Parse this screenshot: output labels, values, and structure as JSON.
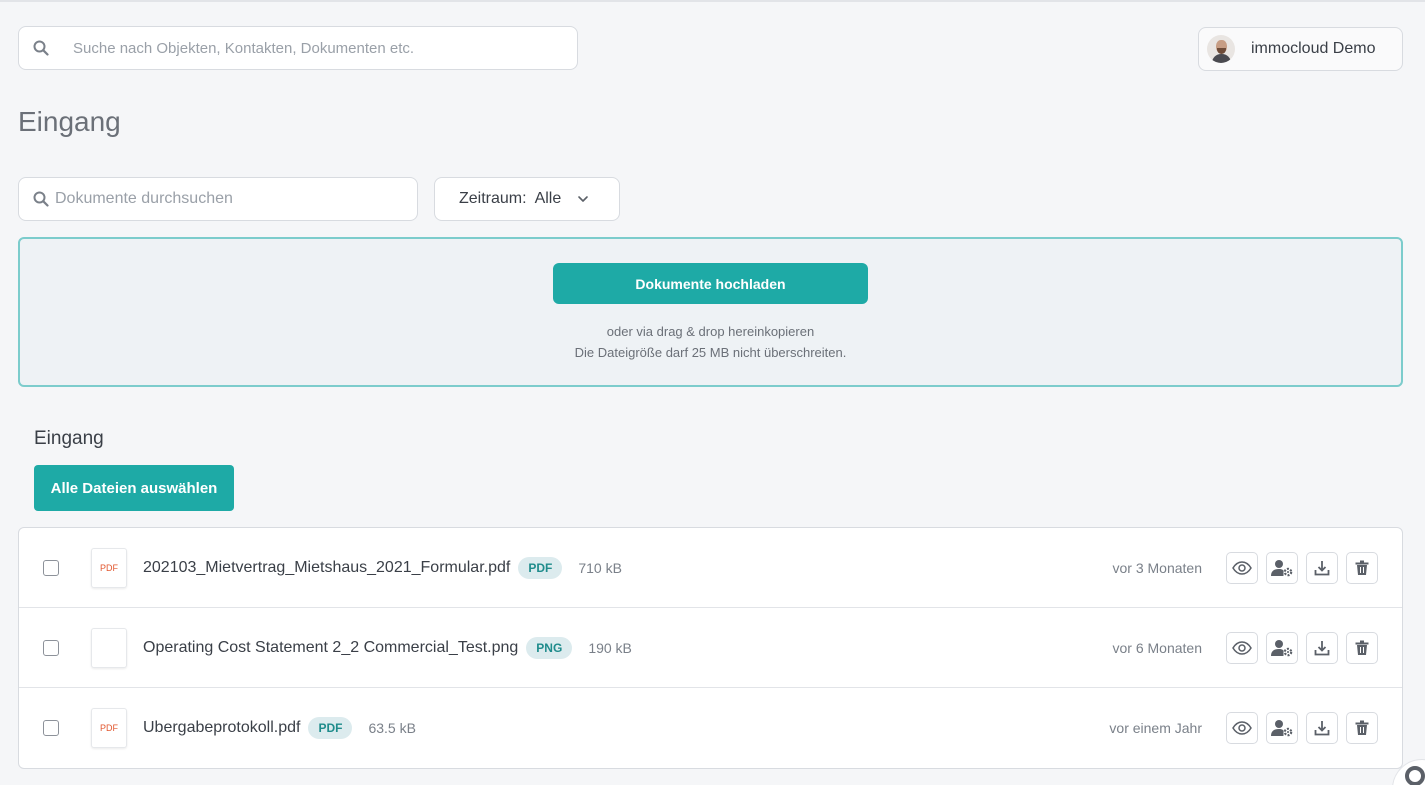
{
  "header": {
    "search_placeholder": "Suche nach Objekten, Kontakten, Dokumenten etc.",
    "user_name": "immocloud Demo"
  },
  "page": {
    "title": "Eingang"
  },
  "filters": {
    "doc_search_placeholder": "Dokumente durchsuchen",
    "period_label": "Zeitraum:",
    "period_value": "Alle"
  },
  "upload": {
    "button_label": "Dokumente hochladen",
    "hint_line1": "oder via drag & drop hereinkopieren",
    "hint_line2": "Die Dateigröße darf 25 MB nicht überschreiten."
  },
  "list": {
    "section_title": "Eingang",
    "select_all_label": "Alle Dateien auswählen",
    "files": [
      {
        "name": "202103_Mietvertrag_Mietshaus_2021_Formular.pdf",
        "type": "PDF",
        "size": "710 kB",
        "date": "vor 3 Monaten",
        "thumb": "PDF"
      },
      {
        "name": "Operating Cost Statement 2_2 Commercial_Test.png",
        "type": "PNG",
        "size": "190 kB",
        "date": "vor 6 Monaten",
        "thumb": ""
      },
      {
        "name": "Ubergabeprotokoll.pdf",
        "type": "PDF",
        "size": "63.5 kB",
        "date": "vor einem Jahr",
        "thumb": "PDF"
      }
    ]
  },
  "colors": {
    "accent": "#1eaaa6",
    "dropzone_border": "#7ccccc",
    "type_badge_bg": "#dcebee",
    "pdf_thumb_text": "#e2572f"
  },
  "icons": {
    "search": "search-icon",
    "chevron": "chevron-down-icon",
    "view": "eye-icon",
    "share": "user-settings-icon",
    "download": "download-icon",
    "delete": "trash-icon"
  }
}
